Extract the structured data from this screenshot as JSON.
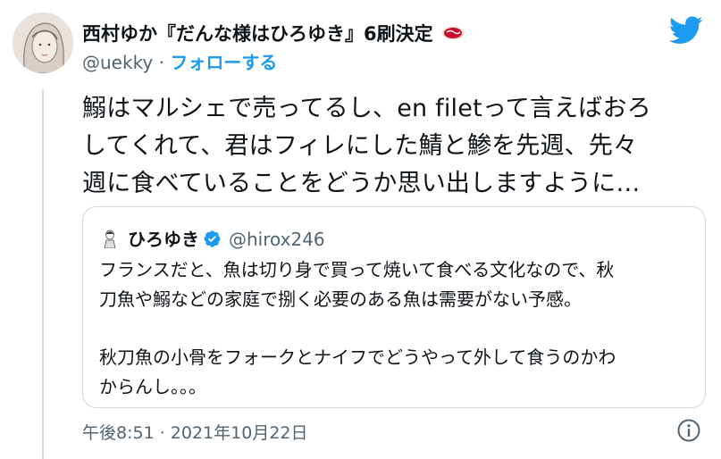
{
  "author": {
    "display_name": "西村ゆか『だんな様はひろゆき』6刷決定",
    "handle": "@uekky",
    "separator": " · ",
    "follow_label": "フォローする"
  },
  "tweet": {
    "lines": [
      "鰯はマルシェで売ってるし、en filetって言えばおろ",
      "してくれて、君はフィレにした鯖と鯵を先週、先々",
      "週に食べていることをどうか思い出しますように…"
    ],
    "timestamp": "午後8:51 · 2021年10月22日"
  },
  "quoted": {
    "display_name": "ひろゆき",
    "handle": "@hirox246",
    "paragraph1": [
      "フランスだと、魚は切り身で買って焼いて食べる文化なので、秋",
      "刀魚や鰯などの家庭で捌く必要のある魚は需要がない予感。"
    ],
    "paragraph2": [
      "秋刀魚の小骨をフォークとナイフでどうやって外して食うのかわ",
      "からんし。。。"
    ]
  },
  "colors": {
    "accent": "#1d9bf0",
    "muted": "#536471",
    "border": "#cfd9de",
    "text": "#0f1419"
  },
  "icons": [
    "meat-emoji-icon",
    "twitter-bird-icon",
    "verified-badge-icon",
    "info-icon"
  ]
}
